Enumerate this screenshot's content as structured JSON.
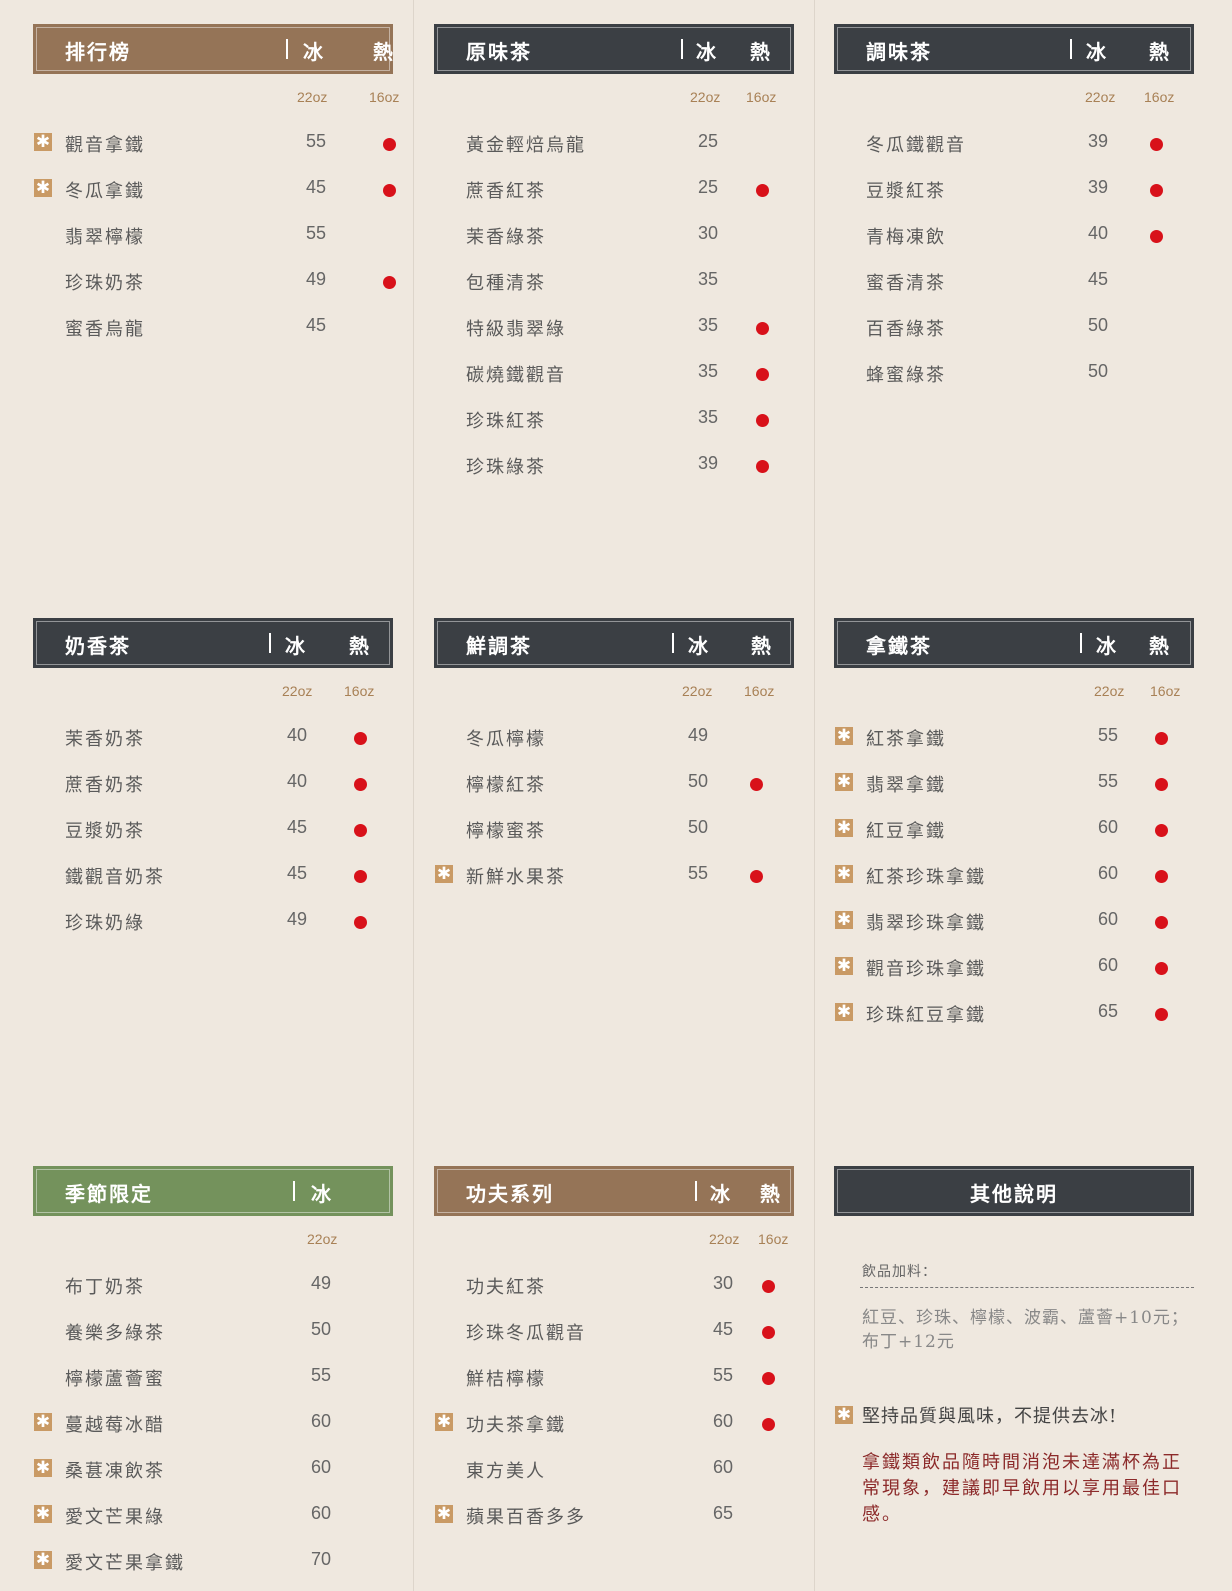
{
  "ice_label": "冰",
  "hot_label": "熱",
  "size_large": "22oz",
  "size_small": "16oz",
  "star_glyph": "✱",
  "colors": {
    "dark": "#3b3f44",
    "brown": "#957457",
    "green": "#74925c",
    "hot_dot": "#d8111a",
    "star_bg": "#c99a65"
  },
  "sections": [
    {
      "title": "排行榜",
      "items": [
        {
          "name": "觀音拿鐵",
          "price": "55",
          "star": true,
          "hot": true
        },
        {
          "name": "冬瓜拿鐵",
          "price": "45",
          "star": true,
          "hot": true
        },
        {
          "name": "翡翠檸檬",
          "price": "55",
          "star": false,
          "hot": false
        },
        {
          "name": "珍珠奶茶",
          "price": "49",
          "star": false,
          "hot": true
        },
        {
          "name": "蜜香烏龍",
          "price": "45",
          "star": false,
          "hot": false
        }
      ]
    },
    {
      "title": "原味茶",
      "items": [
        {
          "name": "黃金輕焙烏龍",
          "price": "25",
          "star": false,
          "hot": false
        },
        {
          "name": "蔗香紅茶",
          "price": "25",
          "star": false,
          "hot": true
        },
        {
          "name": "茉香綠茶",
          "price": "30",
          "star": false,
          "hot": false
        },
        {
          "name": "包種清茶",
          "price": "35",
          "star": false,
          "hot": false
        },
        {
          "name": "特級翡翠綠",
          "price": "35",
          "star": false,
          "hot": true
        },
        {
          "name": "碳燒鐵觀音",
          "price": "35",
          "star": false,
          "hot": true
        },
        {
          "name": "珍珠紅茶",
          "price": "35",
          "star": false,
          "hot": true
        },
        {
          "name": "珍珠綠茶",
          "price": "39",
          "star": false,
          "hot": true
        }
      ]
    },
    {
      "title": "調味茶",
      "items": [
        {
          "name": "冬瓜鐵觀音",
          "price": "39",
          "star": false,
          "hot": true
        },
        {
          "name": "豆漿紅茶",
          "price": "39",
          "star": false,
          "hot": true
        },
        {
          "name": "青梅凍飲",
          "price": "40",
          "star": false,
          "hot": true
        },
        {
          "name": "蜜香清茶",
          "price": "45",
          "star": false,
          "hot": false
        },
        {
          "name": "百香綠茶",
          "price": "50",
          "star": false,
          "hot": false
        },
        {
          "name": "蜂蜜綠茶",
          "price": "50",
          "star": false,
          "hot": false
        }
      ]
    },
    {
      "title": "奶香茶",
      "items": [
        {
          "name": "茉香奶茶",
          "price": "40",
          "star": false,
          "hot": true
        },
        {
          "name": "蔗香奶茶",
          "price": "40",
          "star": false,
          "hot": true
        },
        {
          "name": "豆漿奶茶",
          "price": "45",
          "star": false,
          "hot": true
        },
        {
          "name": "鐵觀音奶茶",
          "price": "45",
          "star": false,
          "hot": true
        },
        {
          "name": "珍珠奶綠",
          "price": "49",
          "star": false,
          "hot": true
        }
      ]
    },
    {
      "title": "鮮調茶",
      "items": [
        {
          "name": "冬瓜檸檬",
          "price": "49",
          "star": false,
          "hot": false
        },
        {
          "name": "檸檬紅茶",
          "price": "50",
          "star": false,
          "hot": true
        },
        {
          "name": "檸檬蜜茶",
          "price": "50",
          "star": false,
          "hot": false
        },
        {
          "name": "新鮮水果茶",
          "price": "55",
          "star": true,
          "hot": true
        }
      ]
    },
    {
      "title": "拿鐵茶",
      "items": [
        {
          "name": "紅茶拿鐵",
          "price": "55",
          "star": true,
          "hot": true
        },
        {
          "name": "翡翠拿鐵",
          "price": "55",
          "star": true,
          "hot": true
        },
        {
          "name": "紅豆拿鐵",
          "price": "60",
          "star": true,
          "hot": true
        },
        {
          "name": "紅茶珍珠拿鐵",
          "price": "60",
          "star": true,
          "hot": true
        },
        {
          "name": "翡翠珍珠拿鐵",
          "price": "60",
          "star": true,
          "hot": true
        },
        {
          "name": "觀音珍珠拿鐵",
          "price": "60",
          "star": true,
          "hot": true
        },
        {
          "name": "珍珠紅豆拿鐵",
          "price": "65",
          "star": true,
          "hot": true
        }
      ]
    },
    {
      "title": "季節限定",
      "items": [
        {
          "name": "布丁奶茶",
          "price": "49",
          "star": false,
          "hot": false
        },
        {
          "name": "養樂多綠茶",
          "price": "50",
          "star": false,
          "hot": false
        },
        {
          "name": "檸檬蘆薈蜜",
          "price": "55",
          "star": false,
          "hot": false
        },
        {
          "name": "蔓越莓冰醋",
          "price": "60",
          "star": true,
          "hot": false
        },
        {
          "name": "桑葚凍飲茶",
          "price": "60",
          "star": true,
          "hot": false
        },
        {
          "name": "愛文芒果綠",
          "price": "60",
          "star": true,
          "hot": false
        },
        {
          "name": "愛文芒果拿鐵",
          "price": "70",
          "star": true,
          "hot": false
        }
      ]
    },
    {
      "title": "功夫系列",
      "items": [
        {
          "name": "功夫紅茶",
          "price": "30",
          "star": false,
          "hot": true
        },
        {
          "name": "珍珠冬瓜觀音",
          "price": "45",
          "star": false,
          "hot": true
        },
        {
          "name": "鮮桔檸檬",
          "price": "55",
          "star": false,
          "hot": true
        },
        {
          "name": "功夫茶拿鐵",
          "price": "60",
          "star": true,
          "hot": true
        },
        {
          "name": "東方美人",
          "price": "60",
          "star": false,
          "hot": false
        },
        {
          "name": "蘋果百香多多",
          "price": "65",
          "star": true,
          "hot": false
        }
      ]
    }
  ],
  "other": {
    "title": "其他說明",
    "topping_label": "飲品加料：",
    "topping_text": "紅豆、珍珠、檸檬、波霸、蘆薈+10元；布丁+12元",
    "no_ice_note": "堅持品質與風味，不提供去冰!",
    "latte_note": "拿鐵類飲品隨時間消泡未達滿杯為正常現象，建議即早飲用以享用最佳口感。"
  }
}
